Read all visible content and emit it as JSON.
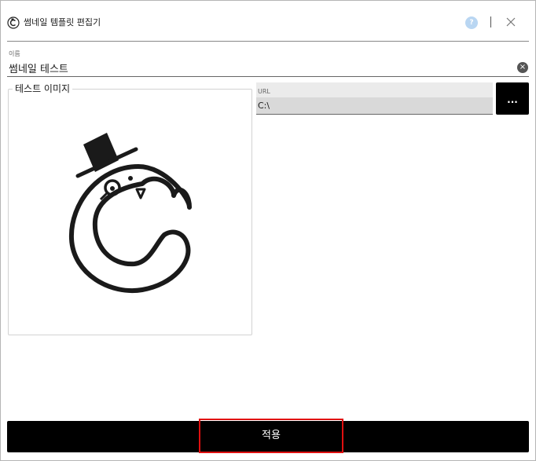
{
  "window": {
    "title": "썸네일 템플릿 편집기",
    "help_label": "?",
    "separator": "|"
  },
  "name_field": {
    "label": "이름",
    "value": "썸네일 테스트",
    "clear_icon": "clear-circle-icon"
  },
  "image_group": {
    "legend": "테스트 이미지"
  },
  "url_field": {
    "label": "URL",
    "value": "C:\\"
  },
  "browse_button": {
    "label": "..."
  },
  "apply_button": {
    "label": "적용"
  },
  "colors": {
    "accent": "#000000",
    "highlight": "#e01010",
    "help": "#b9d6f2"
  }
}
